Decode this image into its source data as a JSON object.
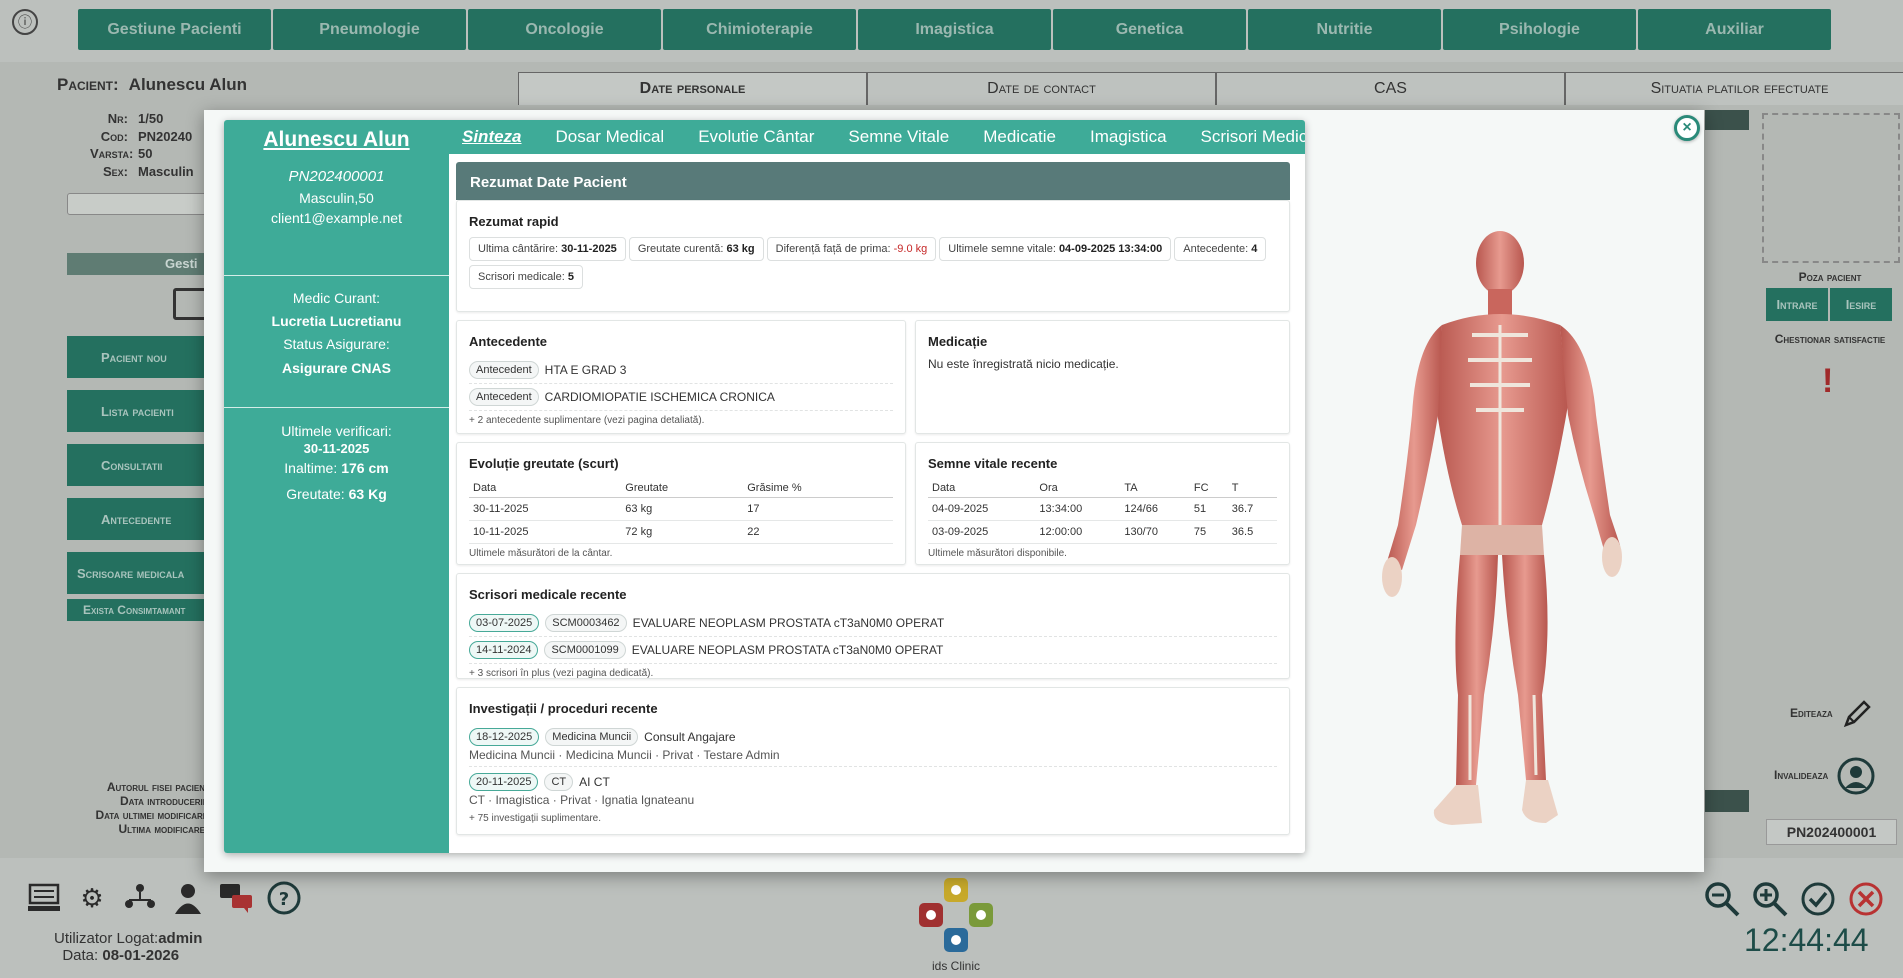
{
  "topnav": [
    "Gestiune Pacienti",
    "Pneumologie",
    "Oncologie",
    "Chimioterapie",
    "Imagistica",
    "Genetica",
    "Nutritie",
    "Psihologie",
    "Auxiliar"
  ],
  "bg": {
    "patient_label": "Pacient:",
    "patient_name": "Alunescu Alun",
    "info": [
      {
        "k": "Nr:",
        "v": "1/50"
      },
      {
        "k": "Cod:",
        "v": "PN20240"
      },
      {
        "k": "Varsta:",
        "v": "50"
      },
      {
        "k": "Sex:",
        "v": "Masculin"
      }
    ],
    "gest_label": "Gesti",
    "side_buttons": [
      "Pacient nou",
      "Lista pacienti",
      "Consultatii",
      "Antecedente",
      "Scrisoare medicala"
    ],
    "small_button": "Exista Consimtamant",
    "tabs": [
      "Date personale",
      "Date de contact",
      "CAS",
      "Situatia platilor efectuate"
    ],
    "poza": "Poza pacient",
    "intrare": "Intrare",
    "iesire": "Iesire",
    "chestionar": "Chestionar satisfactie",
    "exclamation": "!",
    "editeaza": "Editeaza",
    "invalideaza": "Invalideaza",
    "pn": "PN202400001",
    "footer_left": [
      "Autorul fisei pacien",
      "Data introducerii",
      "Data ultimei modificari",
      "Ultima modificare"
    ]
  },
  "bottom": {
    "user_label": "Utilizator Logat:",
    "user": "admin",
    "date_label": "Data:",
    "date": "08-01-2026",
    "logo_text": "ids Clinic",
    "clock": "12:44:44"
  },
  "modal": {
    "close": "×",
    "left": {
      "name": "Alunescu Alun",
      "code": "PN202400001",
      "sex_age": "Masculin,50",
      "email": "client1@example.net",
      "medic_label": "Medic Curant:",
      "medic": "Lucretia Lucretianu",
      "status_label": "Status Asigurare:",
      "status": "Asigurare CNAS",
      "ver_label": "Ultimele verificari:",
      "ver_date": "30-11-2025",
      "height_label": "Inaltime:",
      "height": "176 cm",
      "weight_label": "Greutate:",
      "weight": "63 Kg"
    },
    "tabs": [
      "Sinteza",
      "Dosar Medical",
      "Evolutie Cântar",
      "Semne Vitale",
      "Medicatie",
      "Imagistica",
      "Scrisori Medicale"
    ],
    "header": "Rezumat Date Pacient",
    "quick": {
      "title": "Rezumat rapid",
      "chips": [
        {
          "k": "Ultima cântărire:",
          "v": "30-11-2025"
        },
        {
          "k": "Greutate curentă:",
          "v": "63 kg"
        },
        {
          "k": "Diferență față de prima:",
          "v": "-9.0 kg"
        },
        {
          "k": "Ultimele semne vitale:",
          "v": "04-09-2025 13:34:00"
        },
        {
          "k": "Antecedente:",
          "v": "4"
        },
        {
          "k": "Scrisori medicale:",
          "v": "5"
        }
      ]
    },
    "antecedente": {
      "title": "Antecedente",
      "items": [
        {
          "tag": "Antecedent",
          "text": "HTA E GRAD 3"
        },
        {
          "tag": "Antecedent",
          "text": "CARDIOMIOPATIE ISCHEMICA CRONICA"
        }
      ],
      "note": "+ 2 antecedente suplimentare (vezi pagina detaliată)."
    },
    "medicatie": {
      "title": "Medicație",
      "text": "Nu este înregistrată nicio medicație."
    },
    "greutate": {
      "title": "Evoluție greutate (scurt)",
      "headers": [
        "Data",
        "Greutate",
        "Grăsime %"
      ],
      "rows": [
        [
          "30-11-2025",
          "63 kg",
          "17"
        ],
        [
          "10-11-2025",
          "72 kg",
          "22"
        ]
      ],
      "note": "Ultimele măsurători de la cântar."
    },
    "vitale": {
      "title": "Semne vitale recente",
      "headers": [
        "Data",
        "Ora",
        "TA",
        "FC",
        "T"
      ],
      "rows": [
        [
          "04-09-2025",
          "13:34:00",
          "124/66",
          "51",
          "36.7"
        ],
        [
          "03-09-2025",
          "12:00:00",
          "130/70",
          "75",
          "36.5"
        ]
      ],
      "note": "Ultimele măsurători disponibile."
    },
    "scrisori": {
      "title": "Scrisori medicale recente",
      "items": [
        {
          "date": "03-07-2025",
          "code": "SCM0003462",
          "text": "EVALUARE NEOPLASM PROSTATA cT3aN0M0 OPERAT"
        },
        {
          "date": "14-11-2024",
          "code": "SCM0001099",
          "text": "EVALUARE NEOPLASM PROSTATA cT3aN0M0 OPERAT"
        }
      ],
      "note": "+ 3 scrisori în plus (vezi pagina dedicată)."
    },
    "investigatii": {
      "title": "Investigații / proceduri recente",
      "items": [
        {
          "date": "18-12-2025",
          "tag": "Medicina Muncii",
          "text": "Consult Angajare",
          "sub": "Medicina Muncii · Medicina Muncii · Privat · Testare Admin"
        },
        {
          "date": "20-11-2025",
          "tag": "CT",
          "text": "AI CT",
          "sub": "CT · Imagistica · Privat · Ignatia Ignateanu"
        }
      ],
      "note": "+ 75 investigații suplimentare."
    }
  },
  "colors": {
    "teal": "#3eab98",
    "dark_teal": "#24705f",
    "header": "#587a79",
    "negative": "#c62828"
  }
}
